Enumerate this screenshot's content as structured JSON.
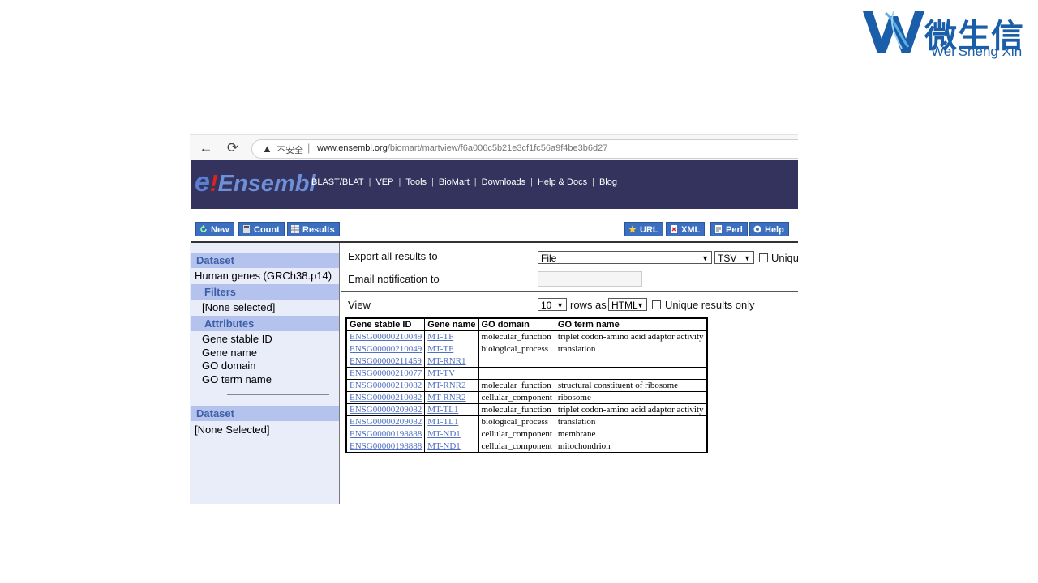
{
  "watermark": {
    "brand_cn": "微生信",
    "brand_en": "Wei Sheng Xin"
  },
  "browser": {
    "insecure_label": "不安全",
    "separator": "|",
    "url_host": "www.ensembl.org",
    "url_path": "/biomart/martview/f6a006c5b21e3cf1fc56a9f4be3b6d27",
    "back_icon": "←",
    "reload_icon": "⟳",
    "warning_icon": "▲"
  },
  "header": {
    "logo_e": "e",
    "logo_bang": "!",
    "logo_text": "Ensembl",
    "nav": [
      "BLAST/BLAT",
      "VEP",
      "Tools",
      "BioMart",
      "Downloads",
      "Help & Docs",
      "Blog"
    ],
    "nav_separator": "|",
    "bg_color": "#33335e"
  },
  "toolbar": {
    "new_label": "New",
    "count_label": "Count",
    "results_label": "Results",
    "url_label": "URL",
    "xml_label": "XML",
    "perl_label": "Perl",
    "help_label": "Help"
  },
  "sidebar": {
    "dataset_heading": "Dataset",
    "dataset_value": "Human genes (GRCh38.p14)",
    "filters_heading": "Filters",
    "filters_value": "[None selected]",
    "attributes_heading": "Attributes",
    "attributes": [
      "Gene stable ID",
      "Gene name",
      "GO domain",
      "GO term name"
    ],
    "dataset2_heading": "Dataset",
    "dataset2_value": "[None Selected]"
  },
  "export": {
    "export_label": "Export  all results to",
    "export_target": "File",
    "format": "TSV",
    "unique_label_cut": "Uniqu",
    "email_label": "Email notification to",
    "view_label": "View",
    "rows_count": "10",
    "rows_as_label": "rows as",
    "view_format": "HTML",
    "unique_results_label": "Unique results only"
  },
  "results": {
    "columns": [
      "Gene stable ID",
      "Gene name",
      "GO domain",
      "GO term name"
    ],
    "rows": [
      [
        "ENSG00000210049",
        "MT-TF",
        "molecular_function",
        "triplet codon-amino acid adaptor activity"
      ],
      [
        "ENSG00000210049",
        "MT-TF",
        "biological_process",
        "translation"
      ],
      [
        "ENSG00000211459",
        "MT-RNR1",
        "",
        ""
      ],
      [
        "ENSG00000210077",
        "MT-TV",
        "",
        ""
      ],
      [
        "ENSG00000210082",
        "MT-RNR2",
        "molecular_function",
        "structural constituent of ribosome"
      ],
      [
        "ENSG00000210082",
        "MT-RNR2",
        "cellular_component",
        "ribosome"
      ],
      [
        "ENSG00000209082",
        "MT-TL1",
        "molecular_function",
        "triplet codon-amino acid adaptor activity"
      ],
      [
        "ENSG00000209082",
        "MT-TL1",
        "biological_process",
        "translation"
      ],
      [
        "ENSG00000198888",
        "MT-ND1",
        "cellular_component",
        "membrane"
      ],
      [
        "ENSG00000198888",
        "MT-ND1",
        "cellular_component",
        "mitochondrion"
      ]
    ]
  }
}
